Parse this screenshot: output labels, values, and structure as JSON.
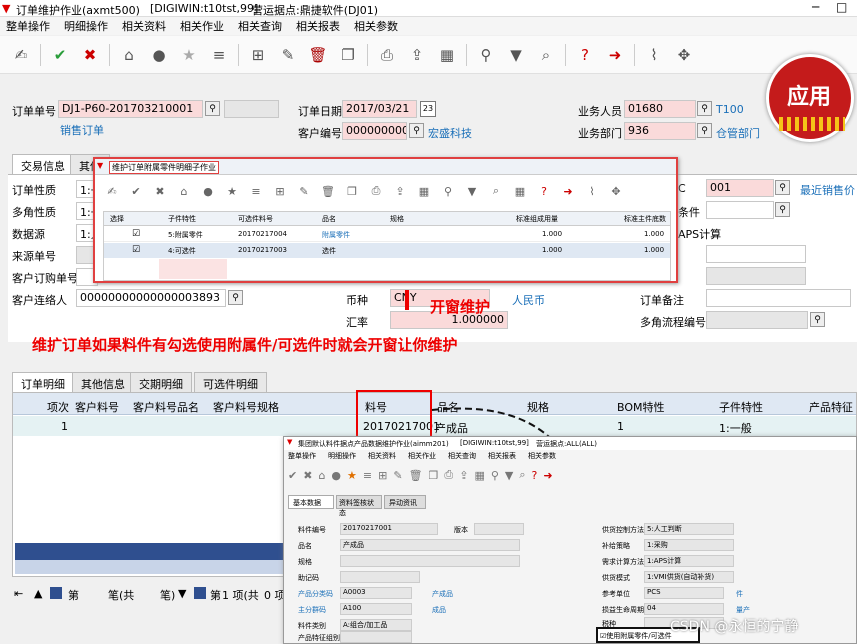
{
  "window": {
    "title": "订单维护作业(axmt500)",
    "server": "[DIGIWIN:t10tst,99]",
    "site": "营运据点:鼎捷软件(DJ01)"
  },
  "menu": [
    "整单操作",
    "明细操作",
    "相关资料",
    "相关作业",
    "相关查询",
    "相关报表",
    "相关参数"
  ],
  "toolbar_icons": [
    "sign-icon",
    "confirm-icon",
    "cancel-icon",
    "home-icon",
    "pin-icon",
    "star-icon",
    "list-icon",
    "add-icon",
    "edit-icon",
    "delete-icon",
    "copy-icon",
    "print-icon",
    "export-icon",
    "grid-icon",
    "search-icon",
    "filter-icon",
    "query-icon",
    "help-icon",
    "exit-icon",
    "attach-icon",
    "move-icon"
  ],
  "apply_badge": "应用",
  "header": {
    "order_no_label": "订单单号",
    "order_no": "DJ1-P60-201703210001",
    "order_type": "销售订单",
    "order_date_label": "订单日期",
    "order_date": "2017/03/21",
    "date_icon": "23",
    "customer_label": "客户编号",
    "customer": "0000000006",
    "customer_name": "宏盛科技",
    "sales_label": "业务人员",
    "sales": "01680",
    "sales_name": "T100",
    "dept_label": "业务部门",
    "dept": "936",
    "dept_name": "仓管部门"
  },
  "tabs_top": [
    "交易信息",
    "其他"
  ],
  "left_labels": [
    "订单性质",
    "多角性质",
    "数据源",
    "来源单号",
    "客户订购单号",
    "客户连络人"
  ],
  "left_values": [
    "1:一",
    "1:一",
    "1:人"
  ],
  "contact": "00000000000000003893",
  "currency_label": "币种",
  "currency": "CNY",
  "currency_name": "人民币",
  "rate_label": "汇率",
  "rate": "1.000000",
  "right_code": "001",
  "right_link": "最近销售价",
  "cond_label": "条件",
  "aps_label": "APS计算",
  "remark_label": "订单备注",
  "flow_label": "多角流程编号",
  "annot_popup": "开窗维护",
  "annot_main": "维扩订单如果料件有勾选使用附属件/可选件时就会开窗让你维护",
  "popup": {
    "title": "维护订单附属零件明细子作业",
    "headers": [
      "选择",
      "子件特性",
      "可选件料号",
      "品名",
      "规格",
      "标准组成用量",
      "标准主件底数"
    ],
    "rows": [
      {
        "check": "☑",
        "feature": "5:附属零件",
        "part": "20170217004",
        "name": "附属零件",
        "spec": "",
        "qty": "1.000",
        "base": "1.000"
      },
      {
        "check": "☑",
        "feature": "4:可选件",
        "part": "20170217003",
        "name": "选件",
        "spec": "",
        "qty": "1.000",
        "base": "1.000"
      }
    ]
  },
  "tabs_bottom": [
    "订单明细",
    "其他信息",
    "交期明细",
    "可选件明细"
  ],
  "grid": {
    "headers": [
      "项次",
      "客户料号",
      "客户料号品名",
      "客户料号规格",
      "料号",
      "品名",
      "规格",
      "BOM特性",
      "子件特性",
      "产品特征"
    ],
    "row": [
      "1",
      "",
      "",
      "",
      "20170217001",
      "产成品",
      "",
      "1",
      "1:一般",
      ""
    ]
  },
  "status": {
    "page": "第",
    "pen": "笔(共",
    "pen2": "笔)",
    "of": "第",
    "item": "1 项(共",
    "zero": "0 项)"
  },
  "inner": {
    "title": "集团默认料件据点产品数据维护作业(aimm201)",
    "server": "[DIGIWIN:t10tst,99]",
    "site": "营运据点:ALL(ALL)",
    "menu": [
      "整单操作",
      "明细操作",
      "相关资料",
      "相关作业",
      "相关查询",
      "相关报表",
      "相关参数"
    ],
    "tabs": [
      "基本数据",
      "资料签核状态",
      "异动资讯"
    ],
    "left": [
      {
        "label": "料件编号",
        "value": "20170217001",
        "extra": "版本"
      },
      {
        "label": "品名",
        "value": "产成品",
        "extra": ""
      },
      {
        "label": "规格",
        "value": "",
        "extra": ""
      },
      {
        "label": "助记码",
        "value": "",
        "extra": ""
      },
      {
        "label": "产品分类码",
        "value": "A0003",
        "extra": "产成品"
      },
      {
        "label": "主分群码",
        "value": "A100",
        "extra": "成品"
      },
      {
        "label": "料件类别",
        "value": "A:组合/加工品",
        "extra": ""
      },
      {
        "label": "产品特征组别",
        "value": "",
        "extra": ""
      }
    ],
    "right": [
      {
        "label": "供货控制方法",
        "value": "5:人工判断"
      },
      {
        "label": "补给策略",
        "value": "1:采购"
      },
      {
        "label": "需求计算方法",
        "value": "1:APS计算"
      },
      {
        "label": "供货模式",
        "value": "1:VMI供货(自动补货)"
      },
      {
        "label": "参考单位",
        "value": "PCS",
        "extra": "件"
      },
      {
        "label": "损益生命周期",
        "value": "04",
        "extra": "量产"
      },
      {
        "label": "税种",
        "value": ""
      }
    ],
    "checkbox": "使用附属零件/可选件"
  },
  "watermark": "CSDN @永恒的宁静"
}
